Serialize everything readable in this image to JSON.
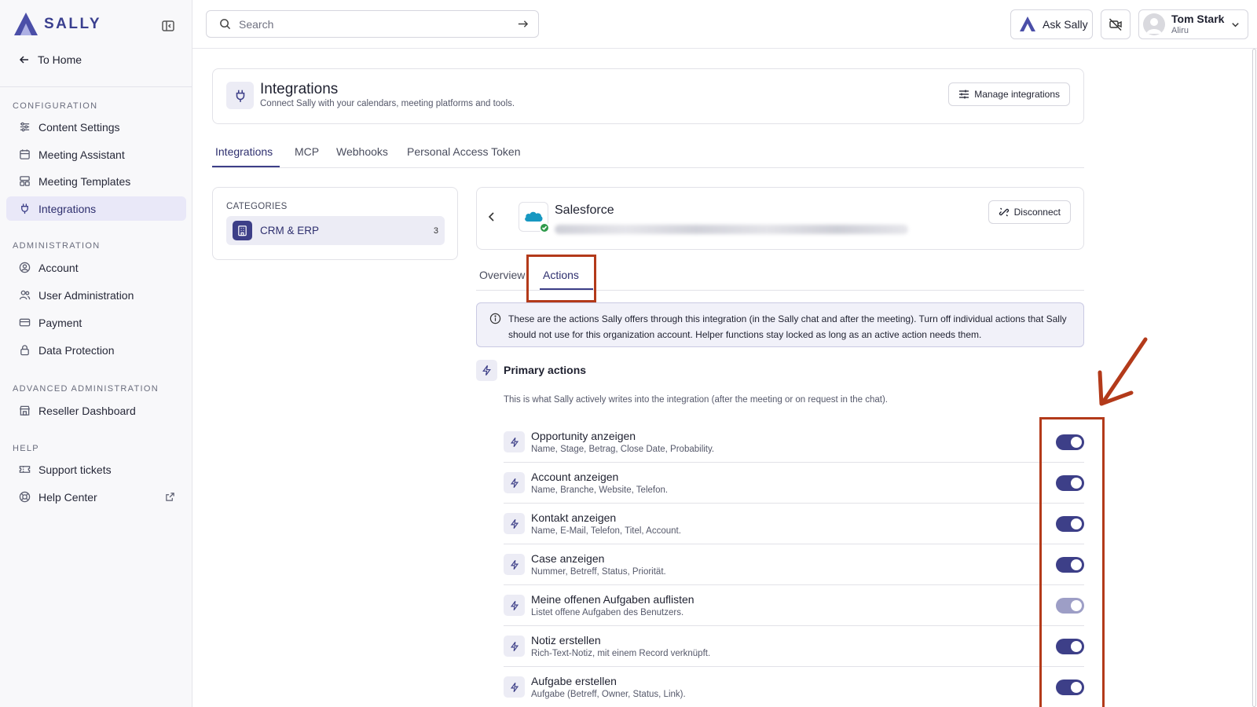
{
  "brand": {
    "name": "SALLY",
    "color": "#3d3f88"
  },
  "sidebar": {
    "back_label": "To Home",
    "sections": [
      {
        "title": "CONFIGURATION",
        "items": [
          {
            "label": "Content Settings",
            "icon": "sliders-icon"
          },
          {
            "label": "Meeting Assistant",
            "icon": "calendar-icon"
          },
          {
            "label": "Meeting Templates",
            "icon": "template-icon"
          },
          {
            "label": "Integrations",
            "icon": "plug-icon",
            "active": true
          }
        ]
      },
      {
        "title": "ADMINISTRATION",
        "items": [
          {
            "label": "Account",
            "icon": "user-circle-icon"
          },
          {
            "label": "User Administration",
            "icon": "users-icon"
          },
          {
            "label": "Payment",
            "icon": "credit-card-icon"
          },
          {
            "label": "Data Protection",
            "icon": "lock-icon"
          }
        ]
      },
      {
        "title": "ADVANCED ADMINISTRATION",
        "items": [
          {
            "label": "Reseller Dashboard",
            "icon": "store-icon"
          }
        ]
      },
      {
        "title": "HELP",
        "items": [
          {
            "label": "Support tickets",
            "icon": "ticket-icon"
          },
          {
            "label": "Help Center",
            "icon": "lifebuoy-icon",
            "external": true
          }
        ]
      }
    ]
  },
  "topbar": {
    "search_placeholder": "Search",
    "ask_label": "Ask Sally",
    "user": {
      "name": "Tom Stark",
      "org": "Aliru"
    }
  },
  "header": {
    "title": "Integrations",
    "subtitle": "Connect Sally with your calendars, meeting platforms and tools.",
    "manage_label": "Manage integrations"
  },
  "tabs": [
    {
      "label": "Integrations",
      "active": true
    },
    {
      "label": "MCP"
    },
    {
      "label": "Webhooks"
    },
    {
      "label": "Personal Access Token"
    }
  ],
  "categories": {
    "label": "CATEGORIES",
    "items": [
      {
        "name": "CRM & ERP",
        "count": "3"
      }
    ]
  },
  "integration": {
    "name": "Salesforce",
    "status": "connected",
    "disconnect_label": "Disconnect",
    "subtabs": [
      {
        "label": "Overview"
      },
      {
        "label": "Actions",
        "active": true
      }
    ],
    "info": "These are the actions Sally offers through this integration (in the Sally chat and after the meeting). Turn off individual actions that Sally should not use for this organization account. Helper functions stay locked as long as an active action needs them.",
    "primary": {
      "title": "Primary actions",
      "description": "This is what Sally actively writes into the integration (after the meeting or on request in the chat).",
      "actions": [
        {
          "title": "Opportunity anzeigen",
          "desc": "Name, Stage, Betrag, Close Date, Probability.",
          "enabled": true
        },
        {
          "title": "Account anzeigen",
          "desc": "Name, Branche, Website, Telefon.",
          "enabled": true
        },
        {
          "title": "Kontakt anzeigen",
          "desc": "Name, E-Mail, Telefon, Titel, Account.",
          "enabled": true
        },
        {
          "title": "Case anzeigen",
          "desc": "Nummer, Betreff, Status, Priorität.",
          "enabled": true
        },
        {
          "title": "Meine offenen Aufgaben auflisten",
          "desc": "Listet offene Aufgaben des Benutzers.",
          "enabled": true,
          "locked": true
        },
        {
          "title": "Notiz erstellen",
          "desc": "Rich-Text-Notiz, mit einem Record verknüpft.",
          "enabled": true
        },
        {
          "title": "Aufgabe erstellen",
          "desc": "Aufgabe (Betreff, Owner, Status, Link).",
          "enabled": true
        }
      ]
    }
  },
  "colors": {
    "accent": "#3d3f88",
    "annotation": "#b33a1a",
    "locked_toggle": "#9d9ec6"
  }
}
